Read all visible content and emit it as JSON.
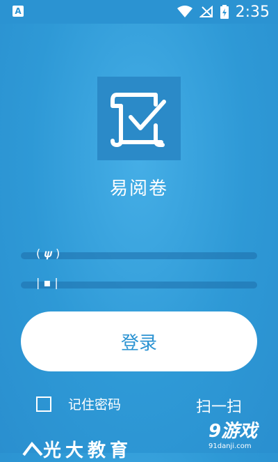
{
  "status_bar": {
    "time": "2:35",
    "left_icon": "A"
  },
  "app": {
    "name": "易阅卷"
  },
  "form": {
    "username_icon": "user-icon",
    "password_icon": "lock-icon"
  },
  "login": {
    "label": "登录"
  },
  "remember": {
    "label": "记住密码",
    "checked": false
  },
  "scan": {
    "label": "扫一扫"
  },
  "footer": {
    "text": "光大教育"
  },
  "watermark": {
    "text": "游戏",
    "num": "9",
    "site": "91danji.com"
  },
  "colors": {
    "background": "#2e99d6",
    "logo_bg": "#2b8ac8",
    "accent": "#2b93d2"
  }
}
